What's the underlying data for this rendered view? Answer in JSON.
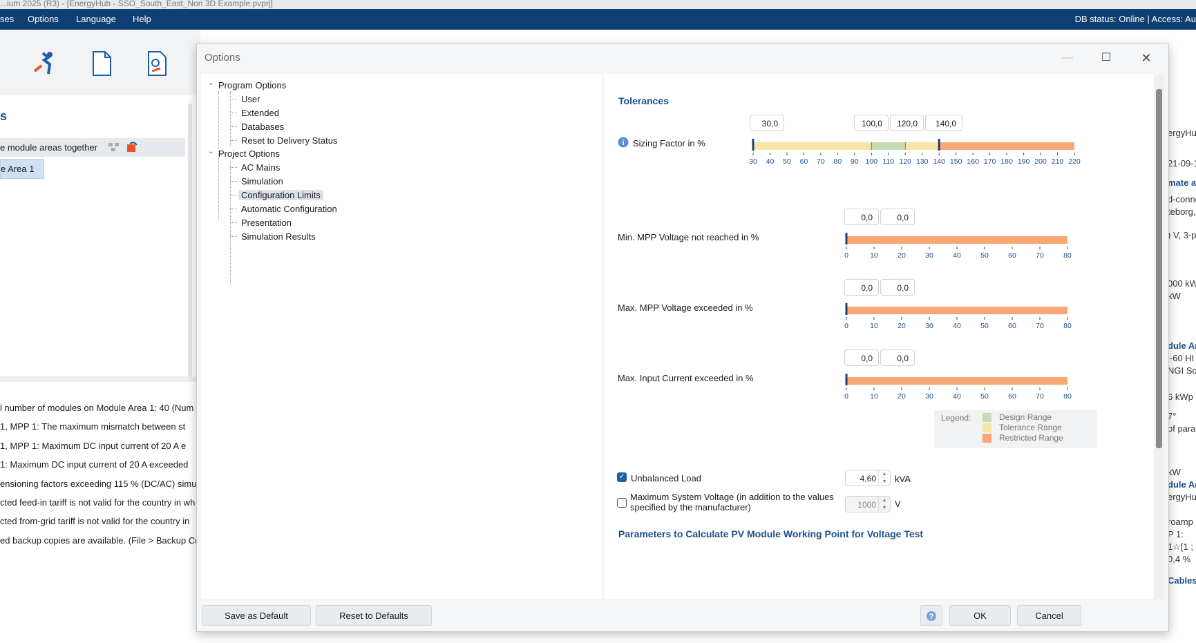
{
  "app": {
    "title_fragment": "...ium 2025 (R3) - [EnergyHub - SSO_South_East_Non 3D Example.pvprj]",
    "menu": [
      "ses",
      "Options",
      "Language",
      "Help"
    ],
    "db_status": "DB status: Online | Access: Au",
    "left_heading": "s",
    "module_areas_label": "e module areas together",
    "area_item": "e Area 1",
    "messages": [
      "l number of modules on Module Area 1: 40 (Num",
      "1, MPP 1:    The maximum mismatch between st",
      "1, MPP 1:    Maximum DC input current of 20 A e",
      "1:    Maximum DC input current of 20 A exceeded",
      "ensioning factors exceeding 115 % (DC/AC) simu",
      "cted feed-in tariff is not valid for the country in wh",
      "cted from-grid tariff is not valid for the country in",
      "ed backup copies are available. (File > Backup Co"
    ],
    "right_fragments": [
      {
        "t": "ergyHu",
        "b": false
      },
      {
        "t": "21-09-1",
        "b": false
      },
      {
        "t": "mate a",
        "b": true
      },
      {
        "t": "d-conne",
        "b": false
      },
      {
        "t": "teborg,",
        "b": false
      },
      {
        "t": ") V, 3-p",
        "b": false
      },
      {
        "t": "000 kW",
        "b": false
      },
      {
        "t": " kW",
        "b": false
      },
      {
        "t": "dule Ar",
        "b": true
      },
      {
        "t": "i-60 HI",
        "b": false
      },
      {
        "t": "NGI So",
        "b": false
      },
      {
        "t": "6 kWp",
        "b": false
      },
      {
        "t": "7°",
        "b": false
      },
      {
        "t": "of para",
        "b": false
      },
      {
        "t": "kW",
        "b": false
      },
      {
        "t": "dule Ar",
        "b": true
      },
      {
        "t": "ergyHu",
        "b": false
      },
      {
        "t": "roamp",
        "b": false
      },
      {
        "t": "P 1:",
        "b": false
      },
      {
        "t": "1☆[1 ;",
        "b": false
      },
      {
        "t": "0,4 %",
        "b": false
      },
      {
        "t": "Cables",
        "b": true
      }
    ]
  },
  "dialog": {
    "title": "Options",
    "tree": {
      "program_options": "Program Options",
      "program_children": [
        "User",
        "Extended",
        "Databases",
        "Reset to Delivery Status"
      ],
      "project_options": "Project Options",
      "project_children": [
        "AC Mains",
        "Simulation",
        "Configuration Limits",
        "Automatic Configuration",
        "Presentation",
        "Simulation Results"
      ],
      "selected": "Configuration Limits"
    },
    "tolerances_heading": "Tolerances",
    "rows": [
      {
        "label": "Sizing Factor in %",
        "values": [
          "30,0",
          "100,0",
          "120,0",
          "140,0"
        ],
        "min": 30,
        "max": 220,
        "ticks": [
          30,
          40,
          50,
          60,
          70,
          80,
          90,
          100,
          110,
          120,
          130,
          140,
          150,
          160,
          170,
          180,
          190,
          200,
          210,
          220
        ],
        "tolerance_from": 30,
        "design_from": 100,
        "design_to": 120,
        "tolerance_to": 140
      },
      {
        "label": "Min. MPP Voltage not reached in %",
        "values": [
          "0,0",
          "0,0"
        ],
        "min": 0,
        "max": 80,
        "ticks": [
          0,
          10,
          20,
          30,
          40,
          50,
          60,
          70,
          80
        ],
        "limit": 0
      },
      {
        "label": "Max. MPP Voltage exceeded in %",
        "values": [
          "0,0",
          "0,0"
        ],
        "min": 0,
        "max": 80,
        "ticks": [
          0,
          10,
          20,
          30,
          40,
          50,
          60,
          70,
          80
        ],
        "limit": 0
      },
      {
        "label": "Max. Input Current exceeded in %",
        "values": [
          "0,0",
          "0,0"
        ],
        "min": 0,
        "max": 80,
        "ticks": [
          0,
          10,
          20,
          30,
          40,
          50,
          60,
          70,
          80
        ],
        "limit": 0
      }
    ],
    "legend": {
      "title": "Legend:",
      "items": [
        {
          "label": "Design Range",
          "color": "#c6dcb4"
        },
        {
          "label": "Tolerance Range",
          "color": "#f8e4a6"
        },
        {
          "label": "Restricted Range",
          "color": "#f9a774"
        }
      ]
    },
    "unbalanced_load": {
      "label": "Unbalanced Load",
      "checked": true,
      "value": "4,60",
      "unit": "kVA"
    },
    "max_system_voltage": {
      "label_line1": "Maximum System Voltage (in addition to the values",
      "label_line2": "specified by the manufacturer)",
      "checked": false,
      "value": "1000",
      "unit": "V"
    },
    "working_point_heading": "Parameters to Calculate PV Module Working Point for Voltage Test",
    "buttons": {
      "save_default": "Save as Default",
      "reset_defaults": "Reset to Defaults",
      "ok": "OK",
      "cancel": "Cancel"
    }
  },
  "colors": {
    "menubar": "#103f73",
    "heading": "#1c4f8c",
    "design": "#c6dcb4",
    "tolerance": "#f8e4a6",
    "restricted": "#f9a774",
    "marker": "#1d3f73"
  }
}
